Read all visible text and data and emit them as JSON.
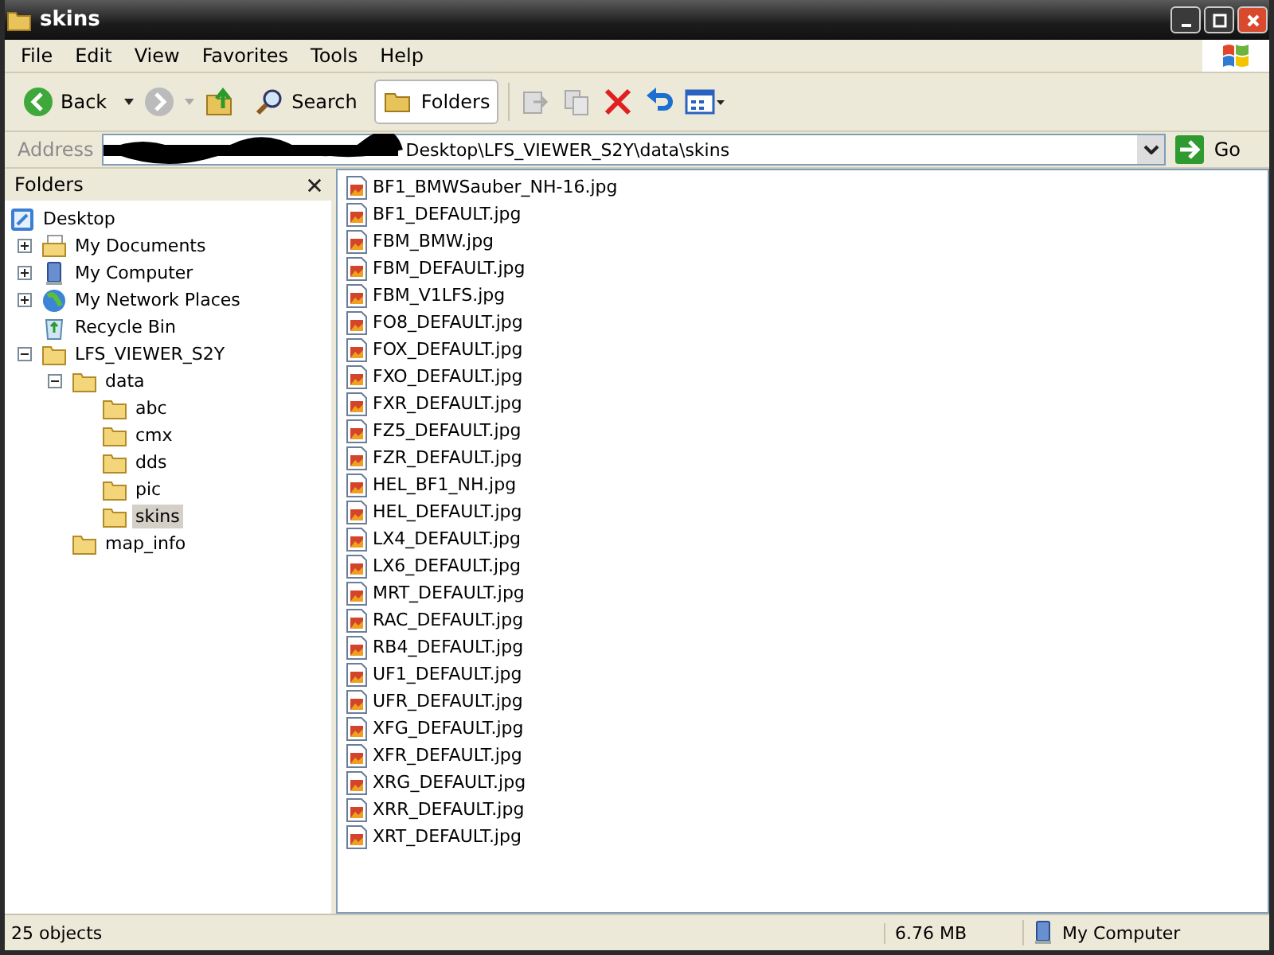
{
  "window": {
    "title": "skins"
  },
  "menu": [
    "File",
    "Edit",
    "View",
    "Favorites",
    "Tools",
    "Help"
  ],
  "toolbar": {
    "back": "Back",
    "search": "Search",
    "folders": {
      "label": "Folders",
      "selected": true
    }
  },
  "address": {
    "label": "Address",
    "value": "Desktop\\LFS_VIEWER_S2Y\\data\\skins",
    "go": "Go"
  },
  "folders_pane": {
    "title": "Folders",
    "tree": [
      {
        "label": "Desktop",
        "kind": "desktop",
        "selected": false,
        "children": [
          {
            "label": "My Documents",
            "kind": "documents",
            "expanded": false,
            "selected": false
          },
          {
            "label": "My Computer",
            "kind": "computer",
            "expanded": false,
            "selected": false
          },
          {
            "label": "My Network Places",
            "kind": "network",
            "expanded": false,
            "selected": false
          },
          {
            "label": "Recycle Bin",
            "kind": "recycle",
            "selected": false
          },
          {
            "label": "LFS_VIEWER_S2Y",
            "kind": "folder",
            "expanded": true,
            "selected": false,
            "children": [
              {
                "label": "data",
                "kind": "folder",
                "expanded": true,
                "selected": false,
                "children": [
                  {
                    "label": "abc",
                    "kind": "folder",
                    "selected": false
                  },
                  {
                    "label": "cmx",
                    "kind": "folder",
                    "selected": false
                  },
                  {
                    "label": "dds",
                    "kind": "folder",
                    "selected": false
                  },
                  {
                    "label": "pic",
                    "kind": "folder",
                    "selected": false
                  },
                  {
                    "label": "skins",
                    "kind": "folder",
                    "selected": true
                  }
                ]
              },
              {
                "label": "map_info",
                "kind": "folder",
                "selected": false
              }
            ]
          }
        ]
      }
    ]
  },
  "files": [
    "BF1_BMWSauber_NH-16.jpg",
    "BF1_DEFAULT.jpg",
    "FBM_BMW.jpg",
    "FBM_DEFAULT.jpg",
    "FBM_V1LFS.jpg",
    "FO8_DEFAULT.jpg",
    "FOX_DEFAULT.jpg",
    "FXO_DEFAULT.jpg",
    "FXR_DEFAULT.jpg",
    "FZ5_DEFAULT.jpg",
    "FZR_DEFAULT.jpg",
    "HEL_BF1_NH.jpg",
    "HEL_DEFAULT.jpg",
    "LX4_DEFAULT.jpg",
    "LX6_DEFAULT.jpg",
    "MRT_DEFAULT.jpg",
    "RAC_DEFAULT.jpg",
    "RB4_DEFAULT.jpg",
    "UF1_DEFAULT.jpg",
    "UFR_DEFAULT.jpg",
    "XFG_DEFAULT.jpg",
    "XFR_DEFAULT.jpg",
    "XRG_DEFAULT.jpg",
    "XRR_DEFAULT.jpg",
    "XRT_DEFAULT.jpg"
  ],
  "status_bar": {
    "count": "25 objects",
    "size": "6.76 MB",
    "zone": "My Computer"
  }
}
